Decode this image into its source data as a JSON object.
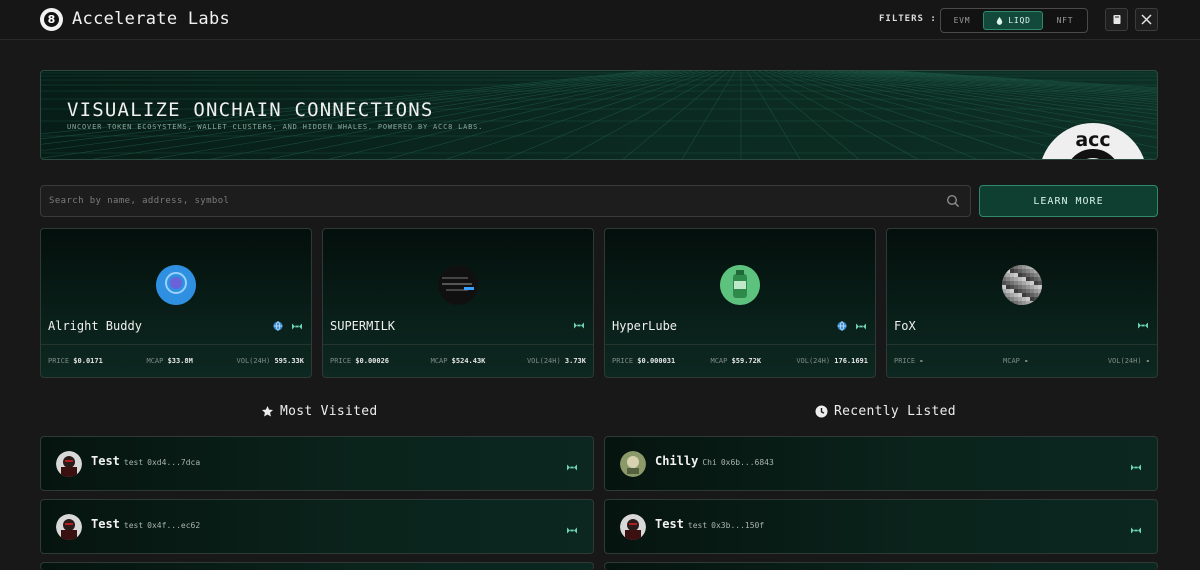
{
  "header": {
    "brand": "Accelerate Labs",
    "logo_glyph": "8",
    "filters_label": "FILTERS :",
    "filters": [
      {
        "label": "EVM",
        "active": false
      },
      {
        "label": "LIQD",
        "active": true
      },
      {
        "label": "NFT",
        "active": false
      }
    ],
    "icons": [
      "book-icon",
      "x-logo-icon"
    ]
  },
  "banner": {
    "title": "VISUALIZE ONCHAIN CONNECTIONS",
    "subtitle": "UNCOVER TOKEN ECOSYSTEMS, WALLET CLUSTERS, AND HIDDEN WHALES. POWERED BY ACC8 LABS.",
    "logo_text": "acc"
  },
  "search": {
    "placeholder": "Search by name, address, symbol"
  },
  "learn_more": "LEARN MORE",
  "stat_labels": {
    "price": "PRICE",
    "mcap": "MCAP",
    "vol": "VOL(24H)"
  },
  "cards": [
    {
      "name": "Alright Buddy",
      "price": "$0.0171",
      "mcap": "$33.8M",
      "vol": "595.33K",
      "has_globe": true,
      "avatar_color": "#3aa3e6"
    },
    {
      "name": "SUPERMILK",
      "price": "$0.00026",
      "mcap": "$524.43K",
      "vol": "3.73K",
      "has_globe": false,
      "avatar_color": "#1b1b1b"
    },
    {
      "name": "HyperLube",
      "price": "$0.000031",
      "mcap": "$59.72K",
      "vol": "176.1691",
      "has_globe": true,
      "avatar_color": "#4fb774"
    },
    {
      "name": "FoX",
      "price": "-",
      "mcap": "-",
      "vol": "-",
      "has_globe": false,
      "avatar_color": "#777777"
    }
  ],
  "sections": {
    "most_visited": "Most Visited",
    "recently_listed": "Recently Listed"
  },
  "most_visited": [
    {
      "name": "Test",
      "symbol": "test",
      "address": "0xd4...7dca"
    },
    {
      "name": "Test",
      "symbol": "test",
      "address": "0x4f...ec62"
    }
  ],
  "recently_listed": [
    {
      "name": "Chilly",
      "symbol": "Chi",
      "address": "0x6b...6843"
    },
    {
      "name": "Test",
      "symbol": "test",
      "address": "0x3b...150f"
    }
  ],
  "colors": {
    "accent": "#2e8a6a",
    "accent_fill": "#0f3f31",
    "background": "#181818"
  }
}
